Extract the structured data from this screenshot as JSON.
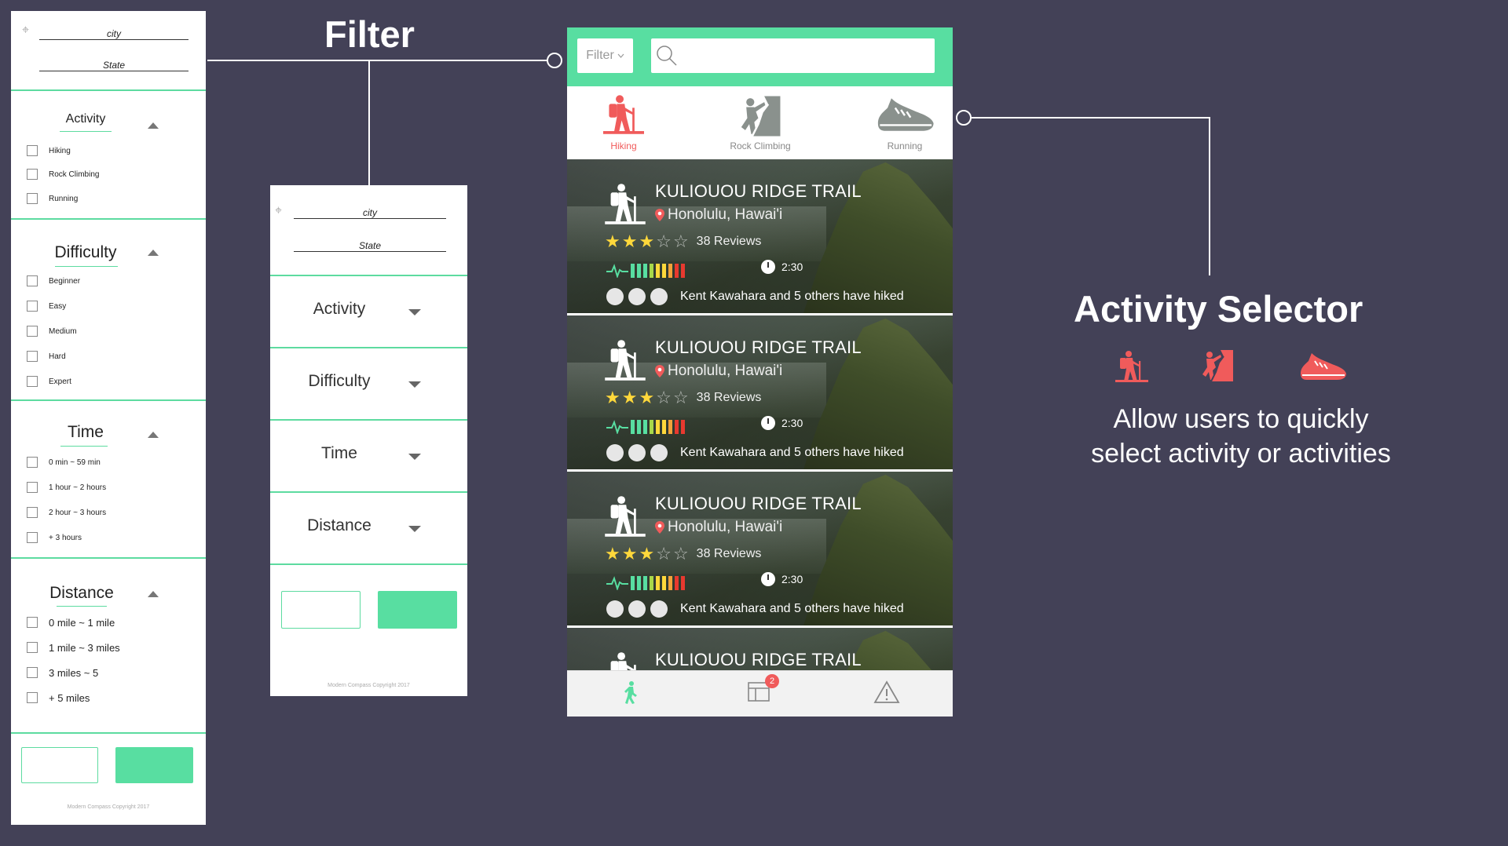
{
  "headings": {
    "filter": "Filter",
    "activity_selector": "Activity Selector",
    "activity_selector_desc_1": "Allow users to quickly",
    "activity_selector_desc_2": "select activity or activities"
  },
  "expanded_filter": {
    "city_label": "city",
    "state_label": "State",
    "sections": [
      {
        "title": "Activity",
        "options": [
          "Hiking",
          "Rock Climbing",
          "Running"
        ]
      },
      {
        "title": "Difficulty",
        "options": [
          "Beginner",
          "Easy",
          "Medium",
          "Hard",
          "Expert"
        ]
      },
      {
        "title": "Time",
        "options": [
          "0 min ~ 59 min",
          "1 hour ~ 2 hours",
          "2 hour ~ 3 hours",
          "+ 3 hours"
        ]
      },
      {
        "title": "Distance",
        "options": [
          "0 mile ~ 1 mile",
          "1 mile ~ 3 miles",
          "3 miles ~ 5",
          "+ 5 miles"
        ]
      }
    ],
    "copyright": "Modern Compass Copyright 2017"
  },
  "collapsed_filter": {
    "city_label": "city",
    "state_label": "State",
    "rows": [
      "Activity",
      "Difficulty",
      "Time",
      "Distance"
    ],
    "copyright": "Modern Compass Copyright 2017"
  },
  "phone": {
    "filter_button": "Filter",
    "search_placeholder": "",
    "activities": [
      {
        "label": "Hiking",
        "icon": "hiking-icon",
        "active": true
      },
      {
        "label": "Rock Climbing",
        "icon": "rock-climbing-icon",
        "active": false
      },
      {
        "label": "Running",
        "icon": "running-shoe-icon",
        "active": false
      }
    ],
    "trails": [
      {
        "name": "KULIOUOU RIDGE TRAIL",
        "location": "Honolulu, Hawai'i",
        "rating": 3,
        "reviews": "38 Reviews",
        "time": "2:30",
        "hiked_name": "Kent Kawahara",
        "hiked_rest": "and 5 others",
        "hiked_suffix": "have hiked"
      },
      {
        "name": "KULIOUOU RIDGE TRAIL",
        "location": "Honolulu, Hawai'i",
        "rating": 3,
        "reviews": "38 Reviews",
        "time": "2:30",
        "hiked_name": "Kent Kawahara",
        "hiked_rest": "and 5 others",
        "hiked_suffix": "have hiked"
      },
      {
        "name": "KULIOUOU RIDGE TRAIL",
        "location": "Honolulu, Hawai'i",
        "rating": 3,
        "reviews": "38 Reviews",
        "time": "2:30",
        "hiked_name": "Kent Kawahara",
        "hiked_rest": "and 5 others",
        "hiked_suffix": "have hiked"
      },
      {
        "name": "KULIOUOU RIDGE TRAIL"
      }
    ],
    "nav_badge": "2"
  },
  "colors": {
    "background": "#434157",
    "accent_green": "#58dea1",
    "active_red": "#f05b5b",
    "star_yellow": "#ffd83b"
  }
}
